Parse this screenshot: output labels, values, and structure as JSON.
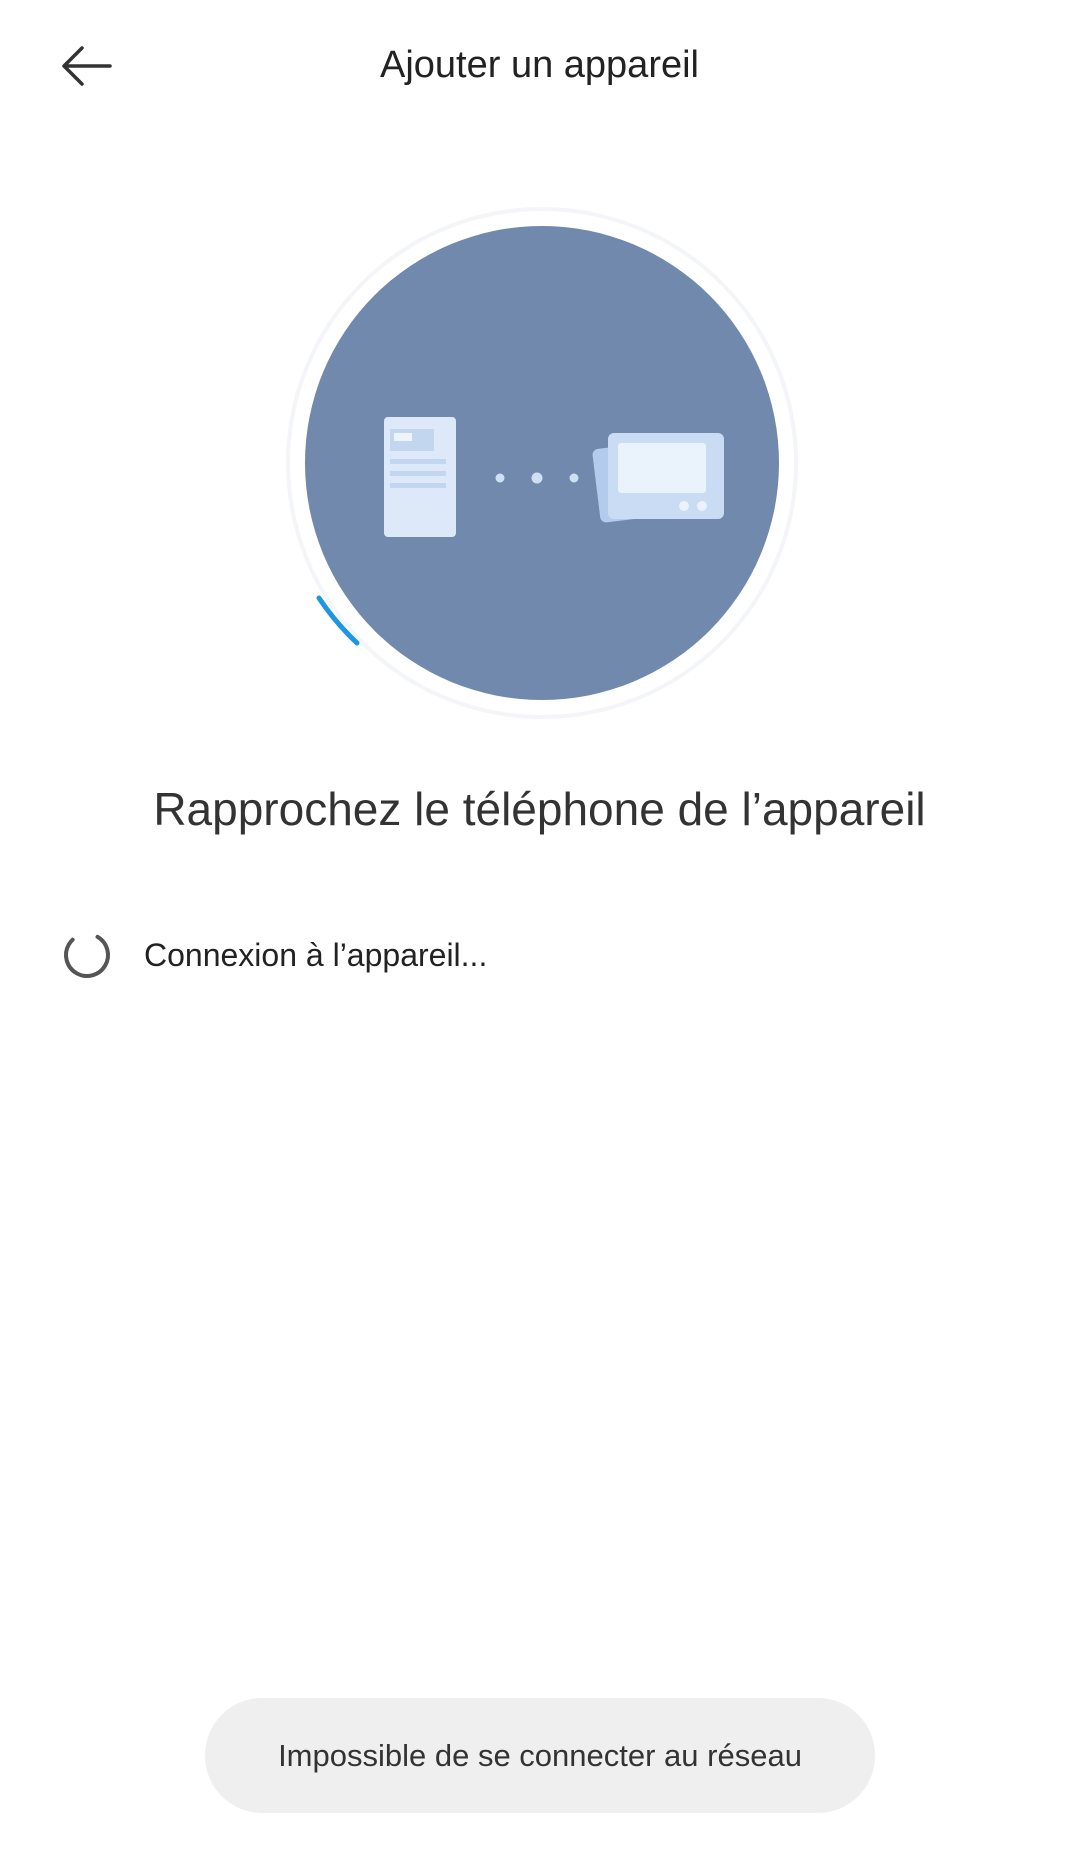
{
  "header": {
    "back_icon": "arrow-left-icon",
    "title": "Ajouter un appareil"
  },
  "illustration": {
    "circle_color": "#7089ac",
    "progress_color": "#1e96e0",
    "phone_icon": "phone-icon",
    "device_icon": "device-icon"
  },
  "instruction": {
    "text": "Rapprochez le téléphone de l’appareil"
  },
  "status": {
    "spinner_icon": "loading-spinner-icon",
    "text": "Connexion à l’appareil..."
  },
  "toast": {
    "text": "Impossible de se connecter au réseau"
  }
}
